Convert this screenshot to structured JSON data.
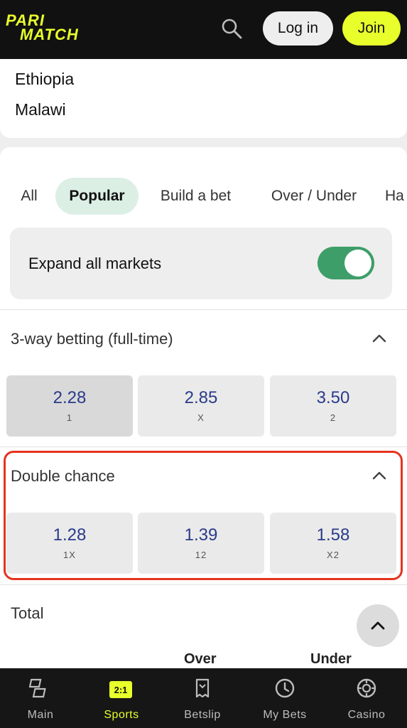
{
  "header": {
    "logo_line1": "PARI",
    "logo_line2": "MATCH",
    "login_label": "Log in",
    "join_label": "Join",
    "brand_color": "#e8ff2b"
  },
  "teams": [
    "Ethiopia",
    "Malawi"
  ],
  "tabs": [
    {
      "label": "All",
      "active": false
    },
    {
      "label": "Popular",
      "active": true
    },
    {
      "label": "Build a bet",
      "active": false
    },
    {
      "label": "Over / Under",
      "active": false
    },
    {
      "label": "Ha",
      "active": false
    }
  ],
  "expand_all": {
    "label": "Expand all markets",
    "on": true,
    "color": "#3e9e69"
  },
  "markets": [
    {
      "title": "3-way betting (full-time)",
      "odds": [
        {
          "value": "2.28",
          "label": "1",
          "selected": true
        },
        {
          "value": "2.85",
          "label": "X",
          "selected": false
        },
        {
          "value": "3.50",
          "label": "2",
          "selected": false
        }
      ]
    },
    {
      "title": "Double chance",
      "highlighted": true,
      "odds": [
        {
          "value": "1.28",
          "label": "1X",
          "selected": false
        },
        {
          "value": "1.39",
          "label": "12",
          "selected": false
        },
        {
          "value": "1.58",
          "label": "X2",
          "selected": false
        }
      ]
    }
  ],
  "total": {
    "title": "Total",
    "col_over": "Over",
    "col_under": "Under"
  },
  "bottom_nav": [
    {
      "label": "Main",
      "icon": "main-icon",
      "active": false
    },
    {
      "label": "Sports",
      "icon": "sports-icon",
      "badge": "2:1",
      "active": true
    },
    {
      "label": "Betslip",
      "icon": "betslip-icon",
      "active": false
    },
    {
      "label": "My Bets",
      "icon": "clock-icon",
      "active": false
    },
    {
      "label": "Casino",
      "icon": "casino-chip-icon",
      "active": false
    }
  ]
}
